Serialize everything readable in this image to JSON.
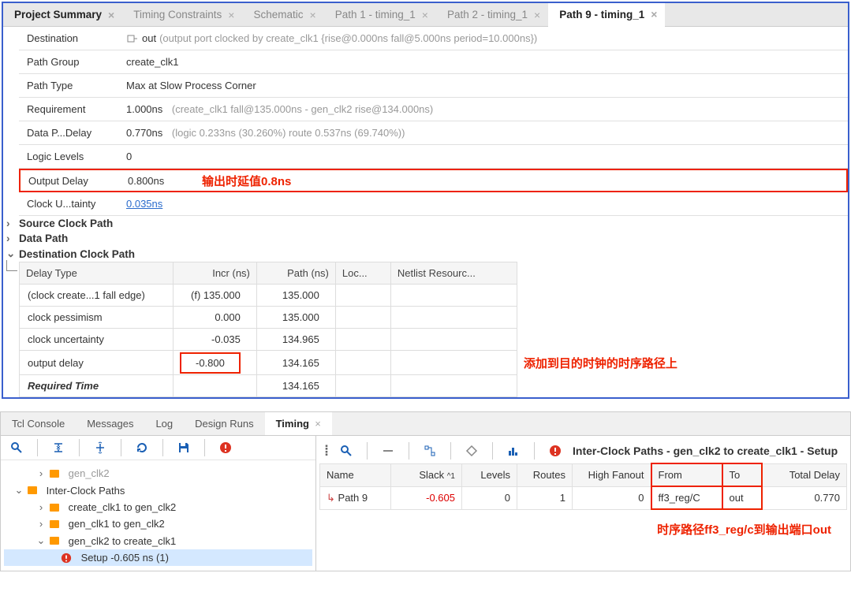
{
  "top_tabs": [
    {
      "label": "Project Summary",
      "active": false,
      "bold": true
    },
    {
      "label": "Timing Constraints",
      "active": false
    },
    {
      "label": "Schematic",
      "active": false
    },
    {
      "label": "Path 1 - timing_1",
      "active": false
    },
    {
      "label": "Path 2 - timing_1",
      "active": false
    },
    {
      "label": "Path 9 - timing_1",
      "active": true
    }
  ],
  "summary": {
    "destination": {
      "label": "Destination",
      "val": "out",
      "extra": "(output port clocked by create_clk1  {rise@0.000ns fall@5.000ns period=10.000ns})"
    },
    "path_group": {
      "label": "Path Group",
      "val": "create_clk1"
    },
    "path_type": {
      "label": "Path Type",
      "val": "Max at Slow Process Corner"
    },
    "requirement": {
      "label": "Requirement",
      "val": "1.000ns",
      "extra": "(create_clk1 fall@135.000ns - gen_clk2 rise@134.000ns)"
    },
    "data_delay": {
      "label": "Data P...Delay",
      "val": "0.770ns",
      "extra": "(logic 0.233ns (30.260%)  route 0.537ns (69.740%))"
    },
    "logic_levels": {
      "label": "Logic Levels",
      "val": "0"
    },
    "output_delay": {
      "label": "Output Delay",
      "val": "0.800ns"
    },
    "clock_uncert": {
      "label": "Clock U...tainty",
      "val": "0.035ns"
    }
  },
  "annotations": {
    "output_delay_note": "输出时延值0.8ns",
    "dest_path_note": "添加到目的时钟的时序路径上",
    "bottom_note": "时序路径ff3_reg/c到输出端口out"
  },
  "sections": {
    "source": "Source Clock Path",
    "data": "Data Path",
    "dest": "Destination Clock Path"
  },
  "dest_table": {
    "headers": [
      "Delay Type",
      "Incr (ns)",
      "Path (ns)",
      "Loc...",
      "Netlist Resourc..."
    ],
    "rows": [
      {
        "type": "(clock create...1 fall edge)",
        "incr": "(f) 135.000",
        "path": "135.000"
      },
      {
        "type": "clock pessimism",
        "incr": "0.000",
        "path": "135.000"
      },
      {
        "type": "clock uncertainty",
        "incr": "-0.035",
        "path": "134.965"
      },
      {
        "type": "output delay",
        "incr": "-0.800",
        "path": "134.165"
      },
      {
        "type": "Required Time",
        "incr": "",
        "path": "134.165",
        "bold": true
      }
    ]
  },
  "bottom_tabs": [
    "Tcl Console",
    "Messages",
    "Log",
    "Design Runs",
    "Timing"
  ],
  "bottom_active": "Timing",
  "tree": {
    "cutoff": "gen_clk2",
    "interclock": "Inter-Clock Paths",
    "items": [
      "create_clk1 to gen_clk2",
      "gen_clk1 to gen_clk2",
      "gen_clk2 to create_clk1"
    ],
    "setup": "Setup -0.605 ns (1)"
  },
  "paths_title": "Inter-Clock Paths - gen_clk2 to create_clk1 - Setup",
  "paths_table": {
    "headers": [
      "Name",
      "Slack",
      "Levels",
      "Routes",
      "High Fanout",
      "From",
      "To",
      "Total Delay"
    ],
    "sort_col": "Slack",
    "row": {
      "name": "Path 9",
      "slack": "-0.605",
      "levels": "0",
      "routes": "1",
      "fanout": "0",
      "from": "ff3_reg/C",
      "to": "out",
      "delay": "0.770"
    }
  }
}
